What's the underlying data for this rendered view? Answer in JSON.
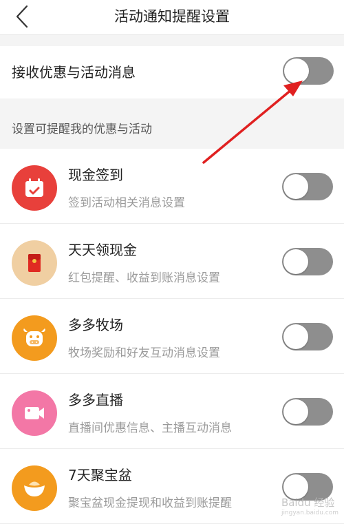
{
  "header": {
    "title": "活动通知提醒设置"
  },
  "main_setting": {
    "label": "接收优惠与活动消息",
    "enabled": false
  },
  "section": {
    "title": "设置可提醒我的优惠与活动"
  },
  "items": [
    {
      "title": "现金签到",
      "desc": "签到活动相关消息设置",
      "icon": "calendar-check-icon",
      "color": "#e8403b",
      "enabled": false
    },
    {
      "title": "天天领现金",
      "desc": "红包提醒、收益到账消息设置",
      "icon": "red-envelope-icon",
      "color": "#f0cfa2",
      "enabled": false
    },
    {
      "title": "多多牧场",
      "desc": "牧场奖励和好友互动消息设置",
      "icon": "cow-icon",
      "color": "#f39b1e",
      "enabled": false
    },
    {
      "title": "多多直播",
      "desc": "直播间优惠信息、主播互动消息",
      "icon": "video-camera-icon",
      "color": "#f377a6",
      "enabled": false
    },
    {
      "title": "7天聚宝盆",
      "desc": "聚宝盆现金提现和收益到账提醒",
      "icon": "treasure-bowl-icon",
      "color": "#f39b1e",
      "enabled": false
    }
  ],
  "colors": {
    "toggle_off": "#8e8e8e",
    "annotation_arrow": "#e02020",
    "background": "#f4f4f4"
  },
  "watermark": {
    "text": "Baidu 经验",
    "sub": "jingyan.baidu.com"
  }
}
